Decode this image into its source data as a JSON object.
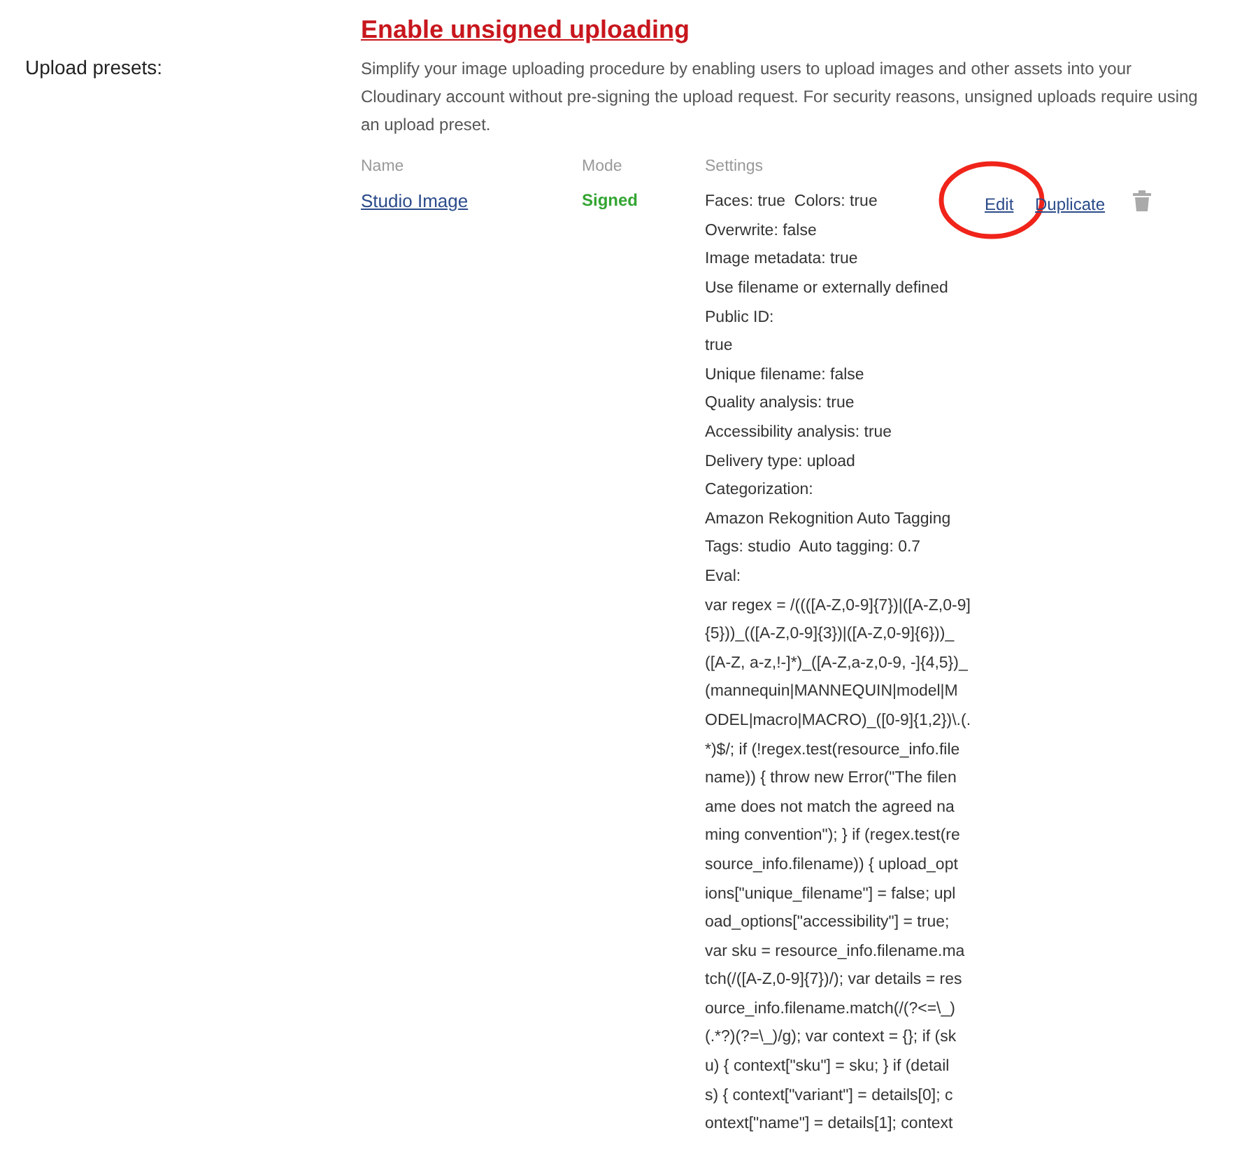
{
  "section_label": "Upload presets:",
  "enable_link": "Enable unsigned uploading",
  "description": "Simplify your image uploading procedure by enabling users to upload images and other assets into your Cloudinary account without pre-signing the upload request. For security reasons, unsigned uploads require using an upload preset.",
  "table": {
    "columns": [
      "Name",
      "Mode",
      "Settings"
    ],
    "rows": [
      {
        "name": "Studio Image",
        "mode": "Signed",
        "signed": true,
        "settings": [
          "Faces: true  Colors: true",
          "Overwrite: false",
          "Image metadata: true",
          "Use filename or externally defined",
          "Public ID:",
          "true",
          "Unique filename: false",
          "Quality analysis: true",
          "Accessibility analysis: true",
          "Delivery type: upload",
          "Categorization:",
          "Amazon Rekognition Auto Tagging",
          "Tags: studio  Auto tagging: 0.7",
          "Eval:",
          "var regex = /((([A-Z,0-9]{7})|([A-Z,0-9]",
          "{5}))_(([A-Z,0-9]{3})|([A-Z,0-9]{6}))_",
          "([A-Z, a-z,!-]*)_([A-Z,a-z,0-9, -]{4,5})_",
          "(mannequin|MANNEQUIN|model|M",
          "ODEL|macro|MACRO)_([0-9]{1,2})\\.(.",
          "*)$/; if (!regex.test(resource_info.file",
          "name)) { throw new Error(\"The filen",
          "ame does not match the agreed na",
          "ming convention\"); } if (regex.test(re",
          "source_info.filename)) { upload_opt",
          "ions[\"unique_filename\"] = false; upl",
          "oad_options[\"accessibility\"] = true;",
          "var sku = resource_info.filename.ma",
          "tch(/([A-Z,0-9]{7})/); var details = res",
          "ource_info.filename.match(/(?<=\\_)",
          "(.*?)(?=\\_)/g); var context = {}; if (sk",
          "u) { context[\"sku\"] = sku; } if (detail",
          "s) { context[\"variant\"] = details[0]; c",
          "ontext[\"name\"] = details[1]; context"
        ],
        "actions": [
          {
            "kind": "link",
            "label": "Edit",
            "circled": true
          },
          {
            "kind": "link",
            "label": "Duplicate",
            "circled": false
          },
          {
            "kind": "delete"
          }
        ]
      }
    ]
  }
}
